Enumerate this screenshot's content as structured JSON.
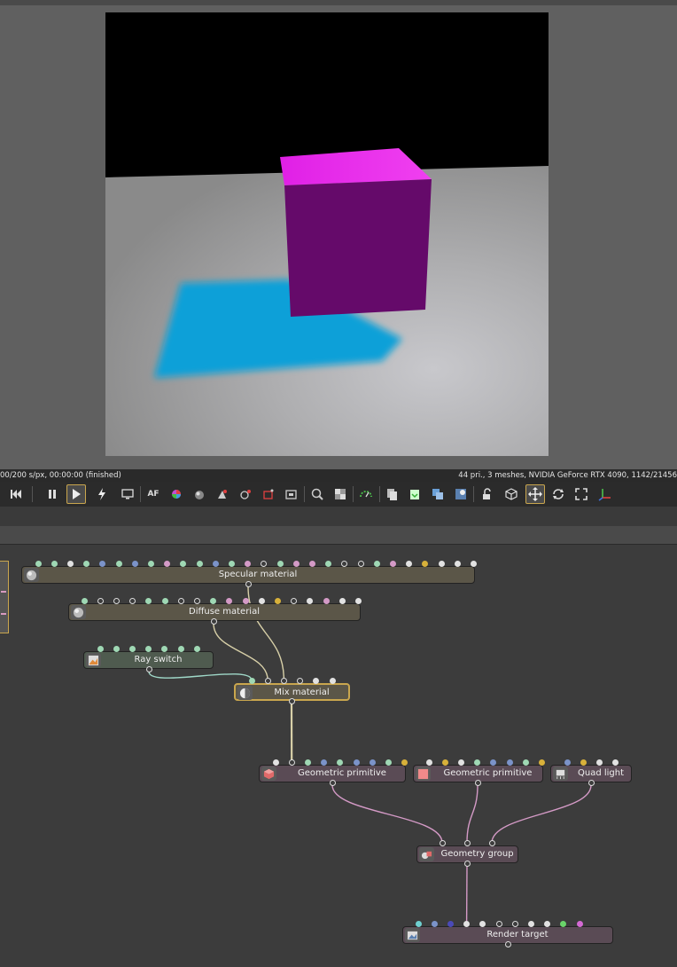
{
  "status": {
    "left": "00/200 s/px, 00:00:00 (finished)",
    "right": "44 pri., 3 meshes, NVIDIA GeForce RTX 4090, 1142/21456"
  },
  "toolbar": {
    "af_label": "AF",
    "tools": [
      "rewind",
      "pause",
      "play",
      "restart",
      "display",
      "af",
      "color-picker",
      "material-picker",
      "light-picker",
      "camera-target",
      "region",
      "film-region",
      "zoom-fit",
      "pixel-ratio",
      "gizmo-color",
      "copy",
      "paste",
      "clone",
      "clay",
      "lock",
      "viewport-mode",
      "move",
      "rotate",
      "fullscreen",
      "axis"
    ]
  },
  "colors": {
    "material": "#5b5648",
    "texture": "#4f5b4f",
    "geometry": "#5a4b55",
    "selected": "#c9a64e",
    "pin_green": "#9fd8b4",
    "pin_white": "#e2e2e2",
    "pin_blue": "#7b93c9",
    "pin_pink": "#d49ac6",
    "pin_yellow": "#d8b13a",
    "pin_teal": "#6fd0d0",
    "pin_orange": "#d89040",
    "pin_navy": "#4a4ab8",
    "pin_lime": "#6ad46a",
    "pin_magenta": "#d46ad4"
  },
  "nodes": [
    {
      "id": "specular",
      "label": "Specular material",
      "type": "material",
      "icon": "sphere-icon",
      "pins": [
        "g",
        "g",
        "w",
        "g",
        "b",
        "g",
        "b",
        "g",
        "p",
        "g",
        "g",
        "b",
        "g",
        "p",
        "o",
        "g",
        "p",
        "p",
        "g",
        "o",
        "o",
        "g",
        "p",
        "w",
        "y",
        "w",
        "w",
        "w"
      ]
    },
    {
      "id": "diffuse",
      "label": "Diffuse material",
      "type": "material",
      "icon": "sphere-icon",
      "pins": [
        "g",
        "o",
        "o",
        "o",
        "g",
        "g",
        "o",
        "o",
        "g",
        "p",
        "p",
        "w",
        "y",
        "o",
        "w",
        "p",
        "w",
        "w"
      ]
    },
    {
      "id": "rayswitch",
      "label": "Ray switch",
      "type": "texture",
      "icon": "texture-icon",
      "pins": [
        "g",
        "g",
        "g",
        "g",
        "g",
        "g",
        "g"
      ]
    },
    {
      "id": "mix",
      "label": "Mix material",
      "type": "material",
      "icon": "mix-icon",
      "selected": true,
      "pins": [
        "g",
        "o",
        "o",
        "o",
        "w",
        "w"
      ]
    },
    {
      "id": "geo1",
      "label": "Geometric primitive",
      "type": "geometry",
      "icon": "cube-icon",
      "pins": [
        "w",
        "o",
        "g",
        "b",
        "g",
        "b",
        "b",
        "g",
        "y"
      ]
    },
    {
      "id": "geo2",
      "label": "Geometric primitive",
      "type": "geometry",
      "icon": "square-icon",
      "pins": [
        "w",
        "y",
        "w",
        "g",
        "b",
        "b",
        "g",
        "y"
      ]
    },
    {
      "id": "quadlight",
      "label": "Quad light",
      "type": "geometry",
      "icon": "light-icon",
      "pins": [
        "b",
        "y",
        "w",
        "w"
      ]
    },
    {
      "id": "group",
      "label": "Geometry group",
      "type": "geometry",
      "icon": "group-icon",
      "pins": []
    },
    {
      "id": "rendertarget",
      "label": "Render target",
      "type": "geometry",
      "icon": "image-icon",
      "pins": [
        "t",
        "b",
        "n",
        "w",
        "w",
        "o",
        "o",
        "w",
        "w",
        "l",
        "m"
      ]
    }
  ]
}
